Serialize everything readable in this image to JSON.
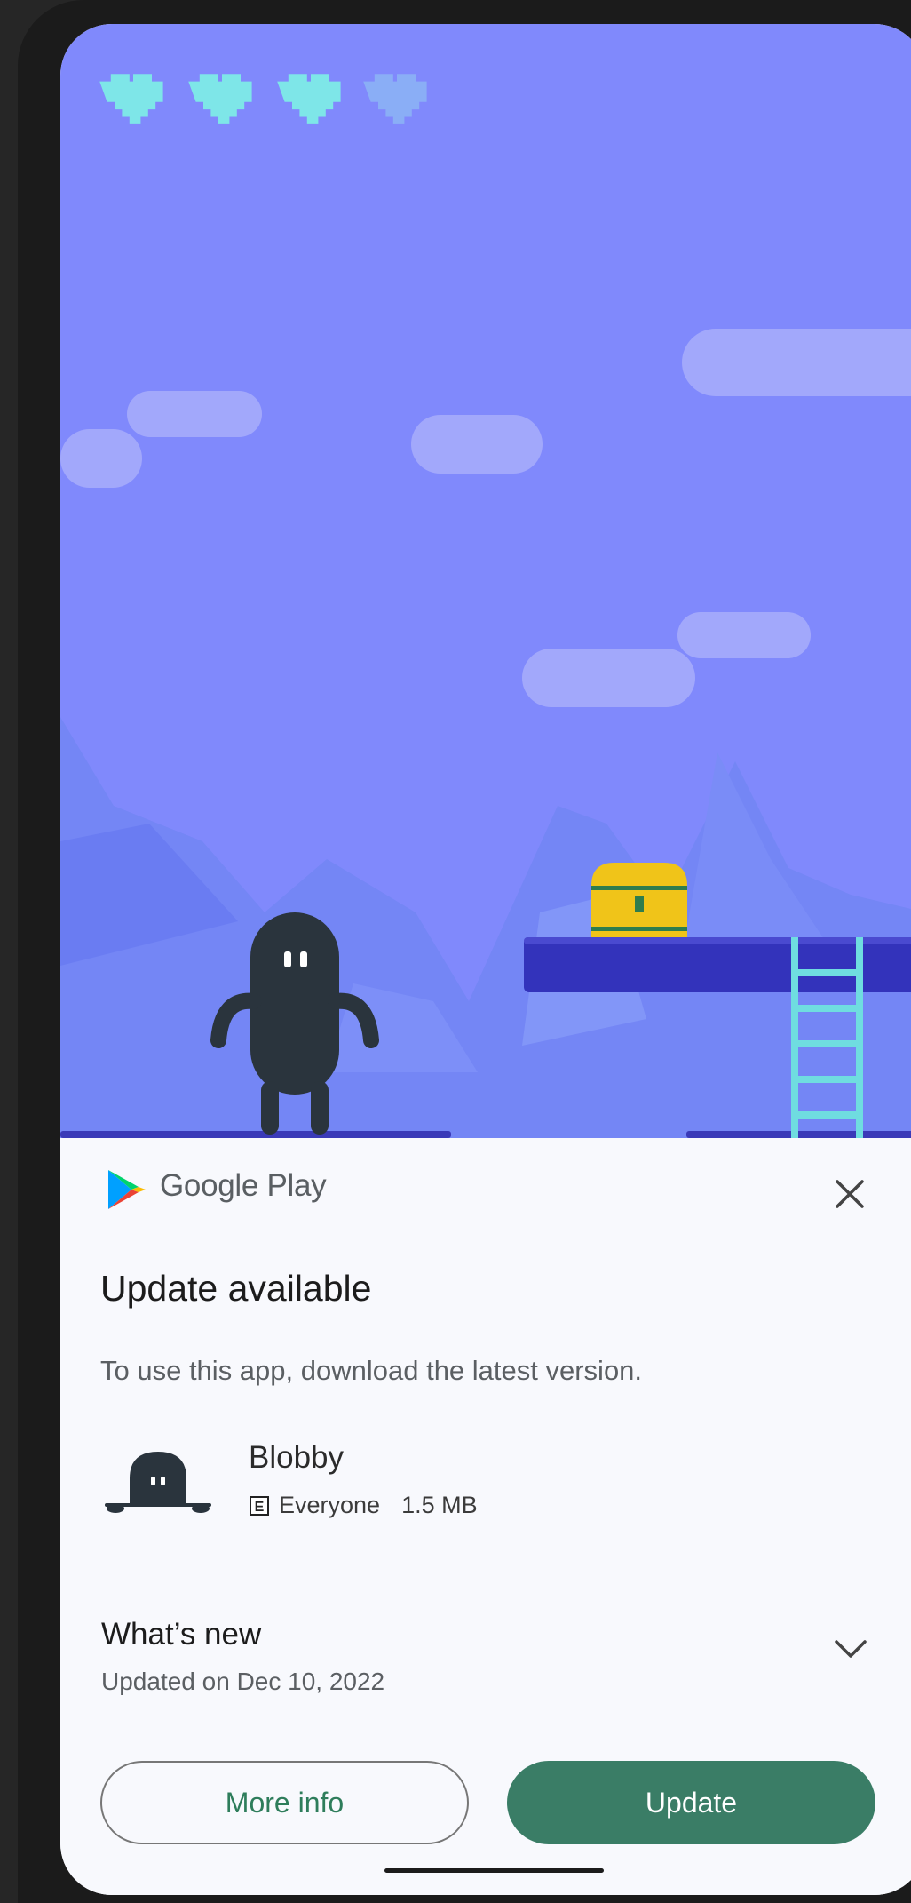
{
  "game": {
    "hearts_total": 4,
    "hearts_filled": 3,
    "colors": {
      "sky": "#8089fc",
      "heart": "#7ee6e8",
      "platform": "#3333bb",
      "chest": "#f0c419",
      "ladder": "#6fdde0"
    }
  },
  "dialog": {
    "store_name": "Google Play",
    "title": "Update available",
    "description": "To use this app, download the latest version.",
    "app": {
      "name": "Blobby",
      "rating": "Everyone",
      "size": "1.5 MB"
    },
    "whats_new": {
      "heading": "What’s new",
      "updated": "Updated on Dec 10, 2022"
    },
    "buttons": {
      "more_info": "More info",
      "update": "Update"
    },
    "colors": {
      "accent": "#3a7d66",
      "sheet_bg": "#f8f9fd"
    },
    "icons": {
      "close": "close-icon",
      "expand": "chevron-down-icon",
      "store": "google-play-logo",
      "rating": "esrb-rating-icon"
    }
  }
}
